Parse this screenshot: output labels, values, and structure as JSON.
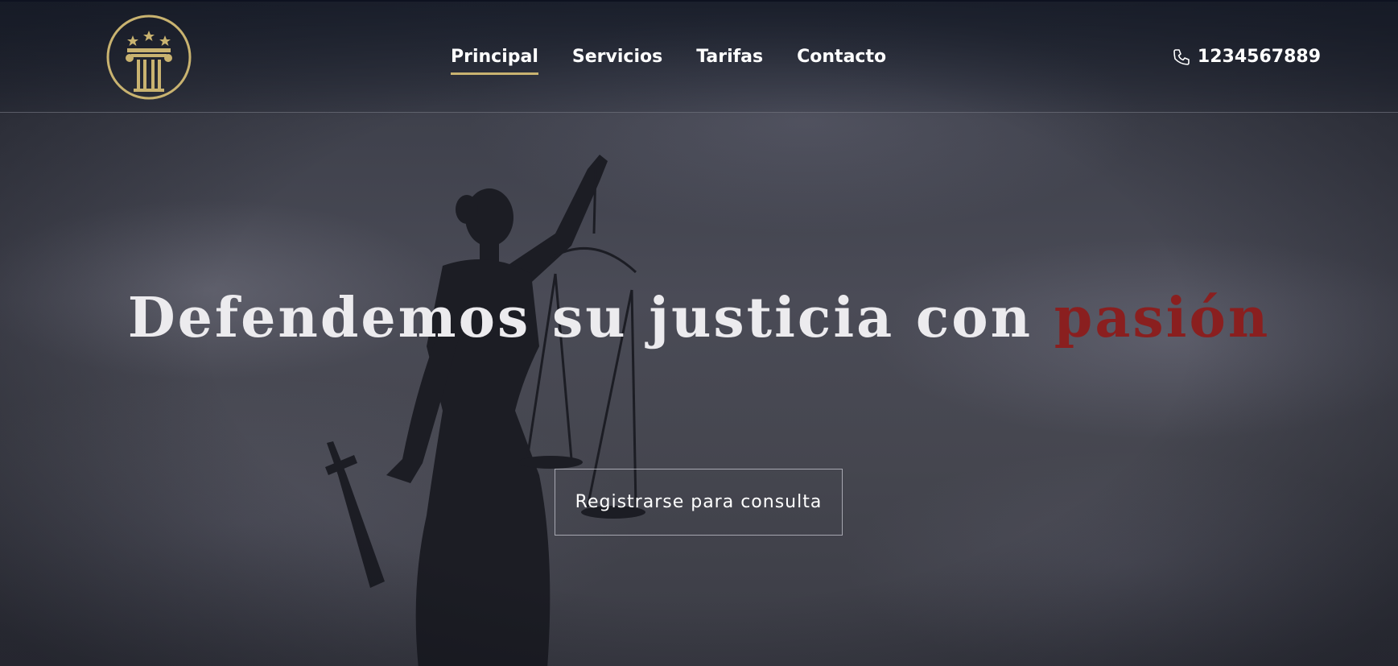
{
  "colors": {
    "accent_gold": "#c9b370",
    "headline_accent_red": "#8a1f1f",
    "text_white": "#ffffff"
  },
  "header": {
    "logo_icon": "pillar-column-logo-icon",
    "nav": [
      {
        "label": "Principal",
        "active": true
      },
      {
        "label": "Servicios",
        "active": false
      },
      {
        "label": "Tarifas",
        "active": false
      },
      {
        "label": "Contacto",
        "active": false
      }
    ],
    "phone": {
      "icon": "phone-icon",
      "number": "1234567889"
    }
  },
  "hero": {
    "background_icon": "lady-justice-statue",
    "headline_main": "Defendemos su justicia con ",
    "headline_accent": "pasión",
    "cta_label": "Registrarse para consulta"
  }
}
